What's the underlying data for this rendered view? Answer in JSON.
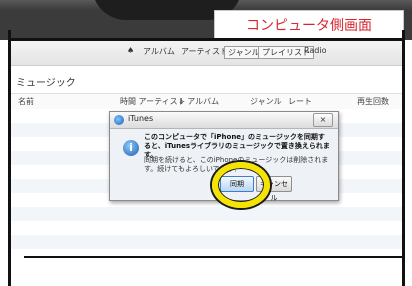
{
  "label": {
    "text": "コンピュータ側画面"
  },
  "toolbar": {
    "items": [
      "♠",
      "アルバム",
      "アーティスト",
      "ジャンル",
      "プレイリスト",
      "Radio"
    ]
  },
  "library": {
    "title": "ミュージック",
    "columns": [
      "名前",
      "時間  アーティスト",
      "↓ アルバム",
      "ジャンル",
      "レート",
      "再生回数"
    ]
  },
  "dialog": {
    "app_title": "iTunes",
    "close_label": "×",
    "message_main": "このコンピュータで「iPhone」のミュージックを同期すると、iTunesライブラリのミュージックで置き換えられます。",
    "message_sub": "同期を続けると、このiPhoneのミュージックは削除されます。続けてもよろしいですか？",
    "primary_button": "同期",
    "secondary_button": "キャンセル"
  },
  "colors": {
    "label_text": "#d6262f",
    "highlight": "#f5e400"
  }
}
